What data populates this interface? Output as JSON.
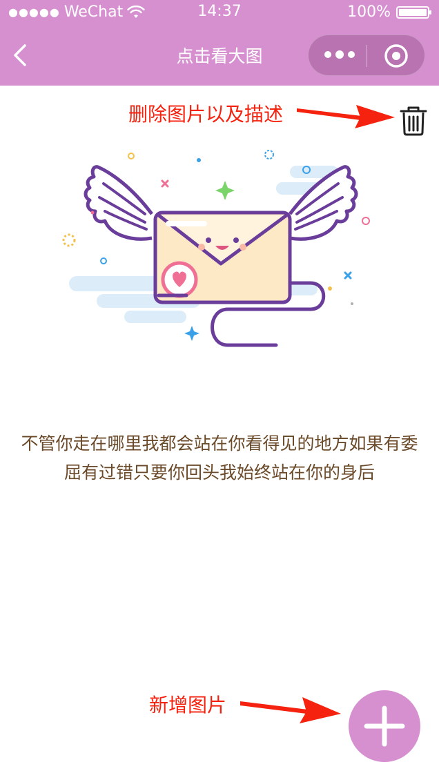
{
  "status_bar": {
    "carrier": "WeChat",
    "time": "14:37",
    "battery": "100%"
  },
  "nav": {
    "title": "点击看大图",
    "back_icon": "chevron-left-icon",
    "more_icon": "more-dots-icon",
    "close_icon": "target-close-icon"
  },
  "annotations": {
    "delete_label": "删除图片以及描述",
    "add_label": "新增图片",
    "color": "#f5220f"
  },
  "content": {
    "quote": "不管你走在哪里我都会站在你看得见的地方如果有委屈有过错只要你回头我始终站在你的身后",
    "illustration": "winged-envelope-illustration"
  },
  "actions": {
    "delete_icon": "trash-icon",
    "add_icon": "plus-icon"
  },
  "colors": {
    "theme": "#d690d0",
    "quote_text": "#6b4a2a",
    "annotation": "#f5220f"
  }
}
